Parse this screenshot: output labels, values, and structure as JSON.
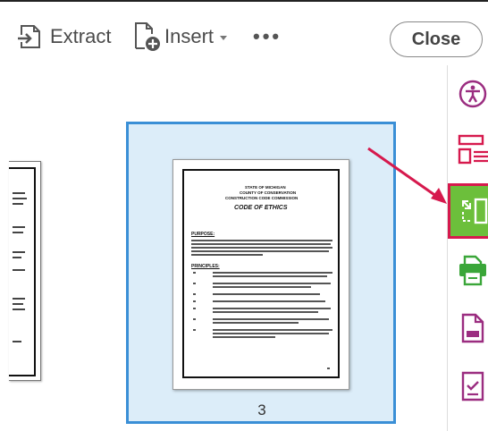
{
  "toolbar": {
    "extract_label": "Extract",
    "insert_label": "Insert",
    "more_label": "•••",
    "close_label": "Close"
  },
  "pages": {
    "selected_page_number": "3",
    "document": {
      "title_lines": [
        "STATE OF MICHIGAN",
        "COUNTY OF CONSERVATION",
        "CONSTRUCTION CODE COMMISSION"
      ],
      "heading": "CODE OF ETHICS",
      "section_1": "PURPOSE:",
      "section_2": "PRINCIPLES:"
    }
  },
  "rail": {
    "icons": [
      "accessibility-icon",
      "form-layout-icon",
      "organize-pages-icon",
      "print-production-icon",
      "export-pdf-icon",
      "checklist-icon"
    ],
    "active_icon": "organize-pages-icon",
    "active_color": "#6cbf3b",
    "highlight_color": "#d6194d"
  },
  "colors": {
    "selection_fill": "#dcedf9",
    "selection_border": "#3a8fd6",
    "icon_color": "#9b2d80",
    "arrow_color": "#d6194d"
  }
}
